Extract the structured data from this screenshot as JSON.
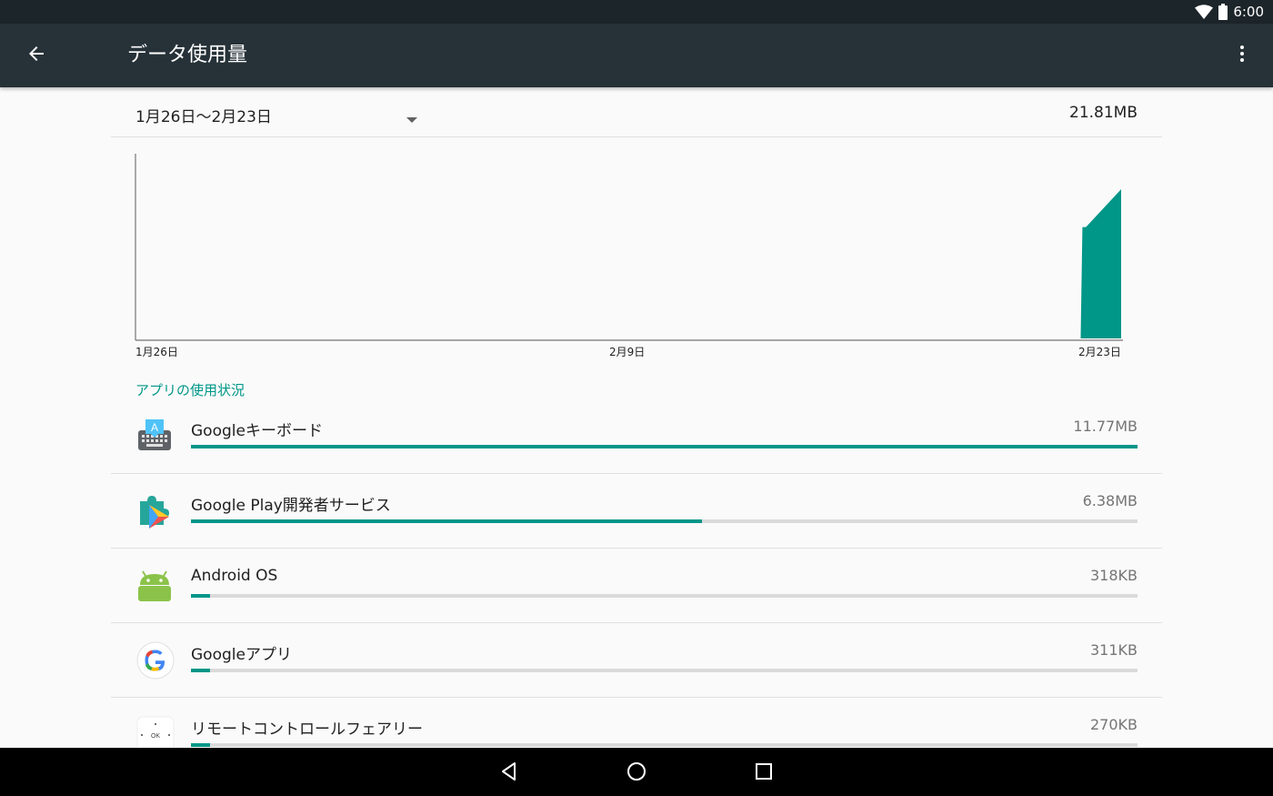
{
  "status_bar": {
    "time": "6:00",
    "icons": [
      "wifi-icon",
      "battery-icon"
    ]
  },
  "toolbar": {
    "title": "データ使用量",
    "back_icon": "arrow-back-icon",
    "menu_icon": "more-vert-icon"
  },
  "cycle": {
    "range": "1月26日～2月23日",
    "total": "21.81MB"
  },
  "chart_data": {
    "type": "area",
    "x_ticks": [
      "1月26日",
      "2月9日",
      "2月23日"
    ],
    "description_series": "data usage over the cycle; flat until a spike on the final days",
    "values": [
      0,
      0,
      0,
      0,
      0,
      0,
      0,
      0,
      0,
      0,
      0,
      0,
      0,
      0,
      0,
      0,
      0,
      0,
      0,
      0,
      0,
      0,
      0,
      0,
      0,
      0,
      0,
      0.85,
      1.0
    ],
    "color": "#009688"
  },
  "section": {
    "title": "アプリの使用状況"
  },
  "apps": [
    {
      "name": "Googleキーボード",
      "usage": "11.77MB",
      "fraction": 1.0,
      "icon": "keyboard-icon"
    },
    {
      "name": "Google Play開発者サービス",
      "usage": "6.38MB",
      "fraction": 0.54,
      "icon": "play-services-icon"
    },
    {
      "name": "Android OS",
      "usage": "318KB",
      "fraction": 0.02,
      "icon": "android-icon"
    },
    {
      "name": "Googleアプリ",
      "usage": "311KB",
      "fraction": 0.02,
      "icon": "google-icon"
    },
    {
      "name": "リモートコントロールフェアリー",
      "usage": "270KB",
      "fraction": 0.02,
      "icon": "remote-control-icon"
    }
  ],
  "icon_text": {
    "keyboard": "A",
    "remote": "OK"
  },
  "colors": {
    "accent": "#009688",
    "toolbar": "#263238",
    "status_bar": "#1c252a"
  }
}
